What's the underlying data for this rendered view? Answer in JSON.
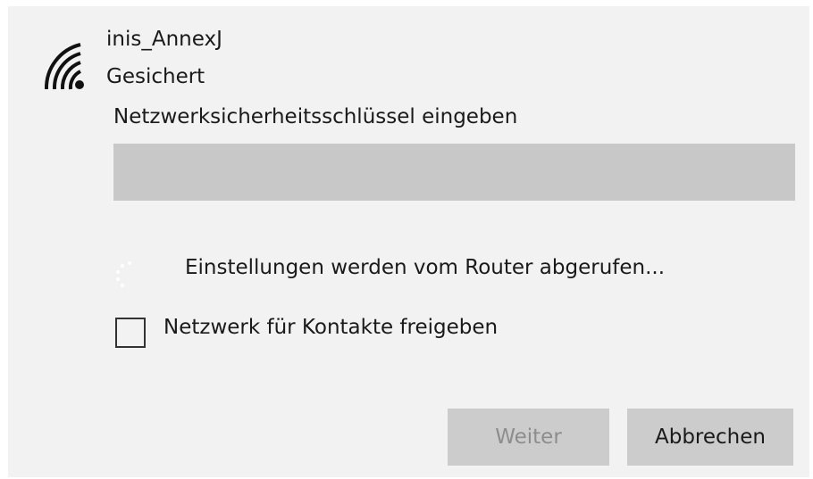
{
  "network": {
    "name": "inis_AnnexJ",
    "status": "Gesichert",
    "icon": "wifi-secured-icon"
  },
  "security_key": {
    "label": "Netzwerksicherheitsschlüssel eingeben",
    "value": "",
    "placeholder": ""
  },
  "progress": {
    "icon": "spinner-icon",
    "text": "Einstellungen werden vom Router abgerufen..."
  },
  "share": {
    "label": "Netzwerk für Kontakte freigeben",
    "checked": false
  },
  "buttons": {
    "next_label": "Weiter",
    "next_enabled": false,
    "cancel_label": "Abbrechen"
  }
}
